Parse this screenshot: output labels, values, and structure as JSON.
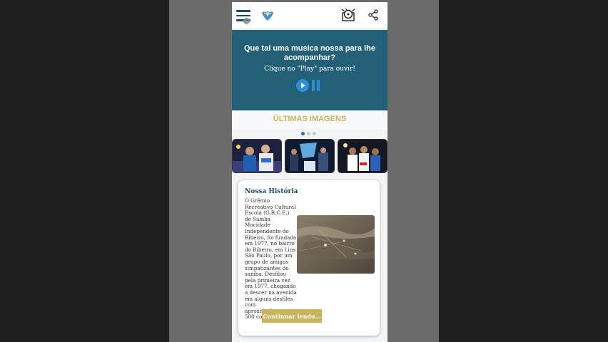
{
  "player": {
    "title": "Que tal uma musica nossa para lhe acompanhar?",
    "subtitle": "Clique no \"Play\" para ouvir!"
  },
  "gallery": {
    "title": "ÚLTIMAS IMAGENS",
    "active_dot": 1,
    "dot_count": 3
  },
  "story": {
    "title": "Nossa História",
    "text": "O Grêmio Recreativo Cultural Escola (G.R.C.E.) de Samba Mocidade Independente do Ribeiro, foi fundado em 1977, no bairro do Ribeiro, em Lins São Paulo, por um grupo de amigos simpatizantes do samba. Desfilou pela primeira vez em 1977, chegando a descer na avenida em alguns desfiles com aproximadamente 500 componentes...",
    "button": "Continuar lendo..."
  },
  "icons": [
    "menu-icon",
    "logo",
    "disc-music-icon",
    "share-icon",
    "play-icon",
    "pause-icon"
  ],
  "colors": {
    "header_blue": "#245f78",
    "accent_gold": "#c8b45d",
    "play_blue": "#2d8fd5"
  }
}
